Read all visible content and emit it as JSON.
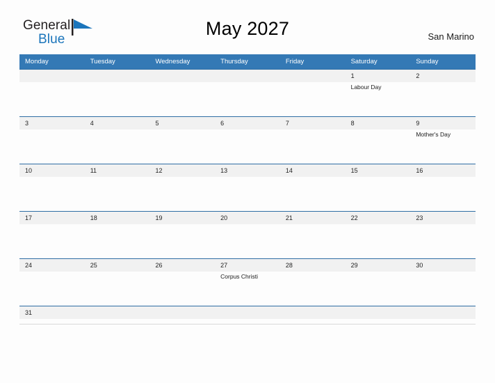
{
  "brand": {
    "name_part1": "General",
    "name_part2": "Blue",
    "flag_icon": "blue-triangle-flag-icon",
    "color_dark": "#231f20",
    "color_blue": "#1b75bb"
  },
  "header": {
    "title": "May 2027",
    "region": "San Marino"
  },
  "theme": {
    "header_blue": "#3479b5",
    "row_border_blue": "#2e6da4",
    "number_band_gray": "#f1f1f1",
    "page_background": "#fdfdfd"
  },
  "calendar": {
    "month": "May",
    "year": "2027",
    "weekday_headers": [
      "Monday",
      "Tuesday",
      "Wednesday",
      "Thursday",
      "Friday",
      "Saturday",
      "Sunday"
    ],
    "weeks": [
      {
        "days": [
          {
            "number": "",
            "events": []
          },
          {
            "number": "",
            "events": []
          },
          {
            "number": "",
            "events": []
          },
          {
            "number": "",
            "events": []
          },
          {
            "number": "",
            "events": []
          },
          {
            "number": "1",
            "events": [
              "Labour Day"
            ]
          },
          {
            "number": "2",
            "events": []
          }
        ]
      },
      {
        "days": [
          {
            "number": "3",
            "events": []
          },
          {
            "number": "4",
            "events": []
          },
          {
            "number": "5",
            "events": []
          },
          {
            "number": "6",
            "events": []
          },
          {
            "number": "7",
            "events": []
          },
          {
            "number": "8",
            "events": []
          },
          {
            "number": "9",
            "events": [
              "Mother's Day"
            ]
          }
        ]
      },
      {
        "days": [
          {
            "number": "10",
            "events": []
          },
          {
            "number": "11",
            "events": []
          },
          {
            "number": "12",
            "events": []
          },
          {
            "number": "13",
            "events": []
          },
          {
            "number": "14",
            "events": []
          },
          {
            "number": "15",
            "events": []
          },
          {
            "number": "16",
            "events": []
          }
        ]
      },
      {
        "days": [
          {
            "number": "17",
            "events": []
          },
          {
            "number": "18",
            "events": []
          },
          {
            "number": "19",
            "events": []
          },
          {
            "number": "20",
            "events": []
          },
          {
            "number": "21",
            "events": []
          },
          {
            "number": "22",
            "events": []
          },
          {
            "number": "23",
            "events": []
          }
        ]
      },
      {
        "days": [
          {
            "number": "24",
            "events": []
          },
          {
            "number": "25",
            "events": []
          },
          {
            "number": "26",
            "events": []
          },
          {
            "number": "27",
            "events": [
              "Corpus Christi"
            ]
          },
          {
            "number": "28",
            "events": []
          },
          {
            "number": "29",
            "events": []
          },
          {
            "number": "30",
            "events": []
          }
        ]
      },
      {
        "days": [
          {
            "number": "31",
            "events": []
          },
          {
            "number": "",
            "events": []
          },
          {
            "number": "",
            "events": []
          },
          {
            "number": "",
            "events": []
          },
          {
            "number": "",
            "events": []
          },
          {
            "number": "",
            "events": []
          },
          {
            "number": "",
            "events": []
          }
        ]
      }
    ]
  }
}
